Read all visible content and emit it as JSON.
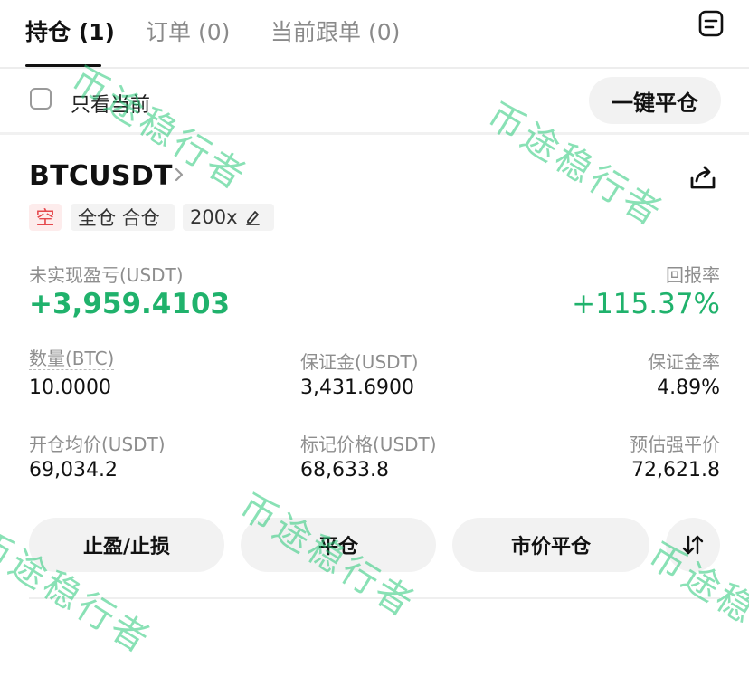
{
  "tabs": [
    {
      "label": "持仓 (1)",
      "active": true
    },
    {
      "label": "订单 (0)",
      "active": false
    },
    {
      "label": "当前跟单 (0)",
      "active": false
    }
  ],
  "icons": {
    "orders": "orders-list-icon",
    "share": "share-icon",
    "edit": "pencil-icon",
    "sort": "sort-arrows-icon",
    "chevron": "chevron-right-icon"
  },
  "filter": {
    "label": "只看当前",
    "checked": false
  },
  "close_all_label": "一键平仓",
  "position": {
    "symbol": "BTCUSDT",
    "side_tag": "空",
    "margin_mode_tag": "全仓 合仓",
    "leverage_tag": "200x",
    "pnl_label": "未实现盈亏(USDT)",
    "pnl_value": "+3,959.4103",
    "roe_label": "回报率",
    "roe_value": "+115.37%",
    "qty_label": "数量(BTC)",
    "qty_value": "10.0000",
    "margin_label": "保证金(USDT)",
    "margin_value": "3,431.6900",
    "margin_ratio_label": "保证金率",
    "margin_ratio_value": "4.89%",
    "entry_label": "开仓均价(USDT)",
    "entry_value": "69,034.2",
    "mark_label": "标记价格(USDT)",
    "mark_value": "68,633.8",
    "liq_label": "预估强平价",
    "liq_value": "72,621.8"
  },
  "actions": {
    "tpsl": "止盈/止损",
    "close": "平仓",
    "market_close": "市价平仓"
  },
  "watermark": "币途稳行者",
  "colors": {
    "profit": "#20b26c",
    "short": "#e5484d",
    "watermark": "#28c878"
  }
}
